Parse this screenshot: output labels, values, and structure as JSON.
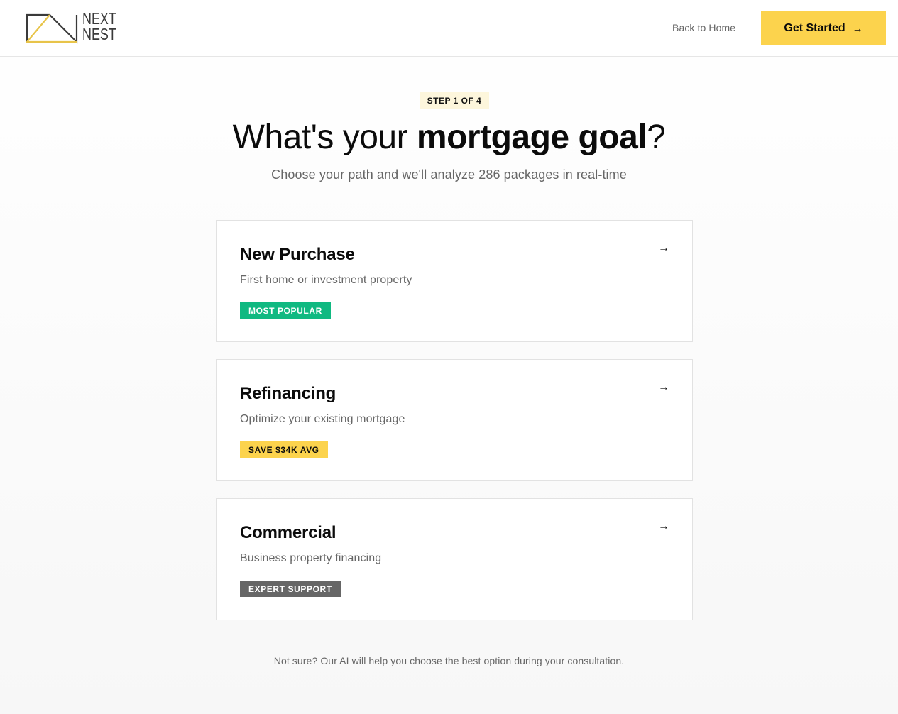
{
  "header": {
    "logo": {
      "line1": "NEXT",
      "line2": "NEST",
      "line_color": "#3a3a3a",
      "accent_color": "#e8c44a"
    },
    "back_link": "Back to Home",
    "cta_label": "Get Started",
    "cta_icon": "arrow-right-icon",
    "cta_color": "#fcd34d"
  },
  "hero": {
    "step": "STEP 1 OF 4",
    "title_regular": "What's your ",
    "title_bold": "mortgage goal",
    "title_end": "?",
    "subtitle": "Choose your path and we'll analyze 286 packages in real-time"
  },
  "options": [
    {
      "title": "New Purchase",
      "description": "First home or investment property",
      "badge": "MOST POPULAR",
      "badge_bg": "#10b981",
      "badge_fg": "#ffffff",
      "icon": "arrow-right-icon"
    },
    {
      "title": "Refinancing",
      "description": "Optimize your existing mortgage",
      "badge": "SAVE $34K AVG",
      "badge_bg": "#fcd34d",
      "badge_fg": "#0b0b0b",
      "icon": "arrow-right-icon"
    },
    {
      "title": "Commercial",
      "description": "Business property financing",
      "badge": "EXPERT SUPPORT",
      "badge_bg": "#666666",
      "badge_fg": "#ffffff",
      "icon": "arrow-right-icon"
    }
  ],
  "footer_note": "Not sure? Our AI will help you choose the best option during your consultation."
}
